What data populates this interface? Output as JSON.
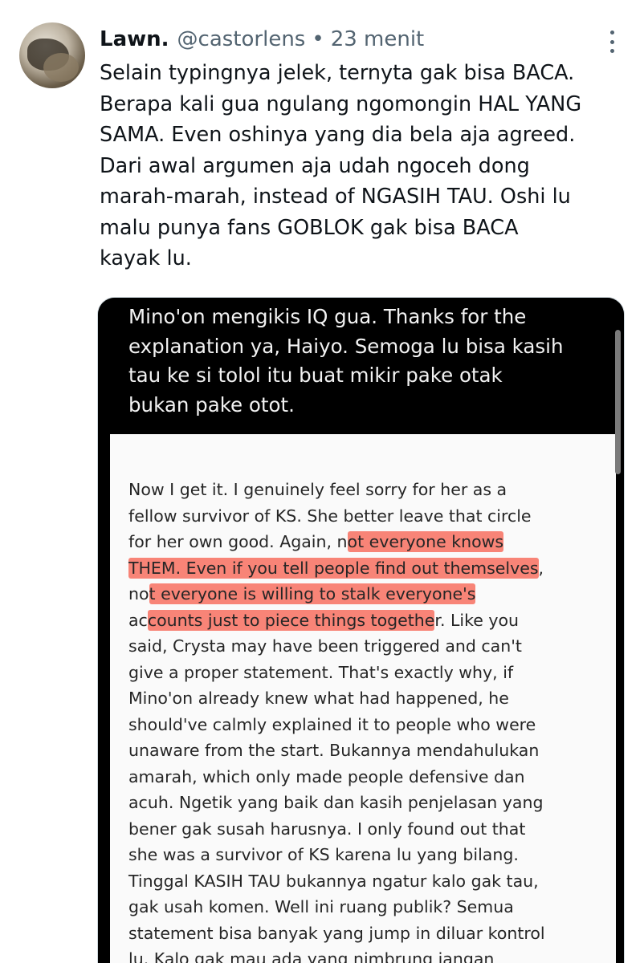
{
  "tweet": {
    "author_name": "Lawn.",
    "handle": "@castorlens",
    "separator": "•",
    "time": "23 menit",
    "lines": [
      "Selain typingnya jelek, ternyta gak bisa BACA.",
      "Berapa kali gua ngulang ngomongin HAL YANG",
      "SAMA. Even oshinya yang dia bela aja agreed.",
      "Dari awal argumen aja udah ngoceh dong",
      "marah-marah, instead of NGASIH TAU. Oshi lu",
      "malu punya fans GOBLOK gak bisa BACA",
      "kayak lu."
    ]
  },
  "screenshot": {
    "dark_lines": [
      "Mino'on mengikis IQ gua. Thanks for the",
      "explanation ya, Haiyo. Semoga lu bisa kasih",
      "tau ke si tolol itu buat mikir pake otak",
      "bukan pake otot."
    ],
    "light_lines": [
      {
        "before": "Now I get it. I genuinely feel sorry for her as a",
        "highlight": "",
        "after": ""
      },
      {
        "before": "fellow survivor of KS. She better leave that circle",
        "highlight": "",
        "after": ""
      },
      {
        "before": "for her own good. Again, n",
        "highlight": "ot everyone knows",
        "after": ""
      },
      {
        "before": "",
        "highlight": "THEM. Even if you tell people find out themselves",
        "after": ","
      },
      {
        "before": "no",
        "highlight": "t everyone is willing to stalk everyone's",
        "after": ""
      },
      {
        "before": "ac",
        "highlight": "counts just to piece things togethe",
        "after": "r. Like you"
      },
      {
        "before": "said, Crysta may have been triggered and can't",
        "highlight": "",
        "after": ""
      },
      {
        "before": "give a proper statement. That's exactly why, if",
        "highlight": "",
        "after": ""
      },
      {
        "before": "Mino'on already knew what had happened, he",
        "highlight": "",
        "after": ""
      },
      {
        "before": "should've calmly explained it to people who were",
        "highlight": "",
        "after": ""
      },
      {
        "before": "unaware from the start. Bukannya mendahulukan",
        "highlight": "",
        "after": ""
      },
      {
        "before": "amarah, which only made people defensive dan",
        "highlight": "",
        "after": ""
      },
      {
        "before": "acuh. Ngetik yang baik dan kasih penjelasan yang",
        "highlight": "",
        "after": ""
      },
      {
        "before": "bener gak susah harusnya. I only found out that",
        "highlight": "",
        "after": ""
      },
      {
        "before": "she was a survivor of KS karena lu yang bilang.",
        "highlight": "",
        "after": ""
      },
      {
        "before": "Tinggal KASIH TAU bukannya ngatur kalo gak tau,",
        "highlight": "",
        "after": ""
      },
      {
        "before": "gak usah komen. Well ini ruang publik? Semua",
        "highlight": "",
        "after": ""
      },
      {
        "before": "statement bisa banyak yang jump in diluar kontrol",
        "highlight": "",
        "after": ""
      },
      {
        "before": "lu. Kalo gak mau ada yang nimbrung jangan",
        "highlight": "",
        "after": ""
      }
    ]
  },
  "colors": {
    "text": "#0f1419",
    "secondary": "#536471",
    "highlight": "#f76e5f"
  }
}
